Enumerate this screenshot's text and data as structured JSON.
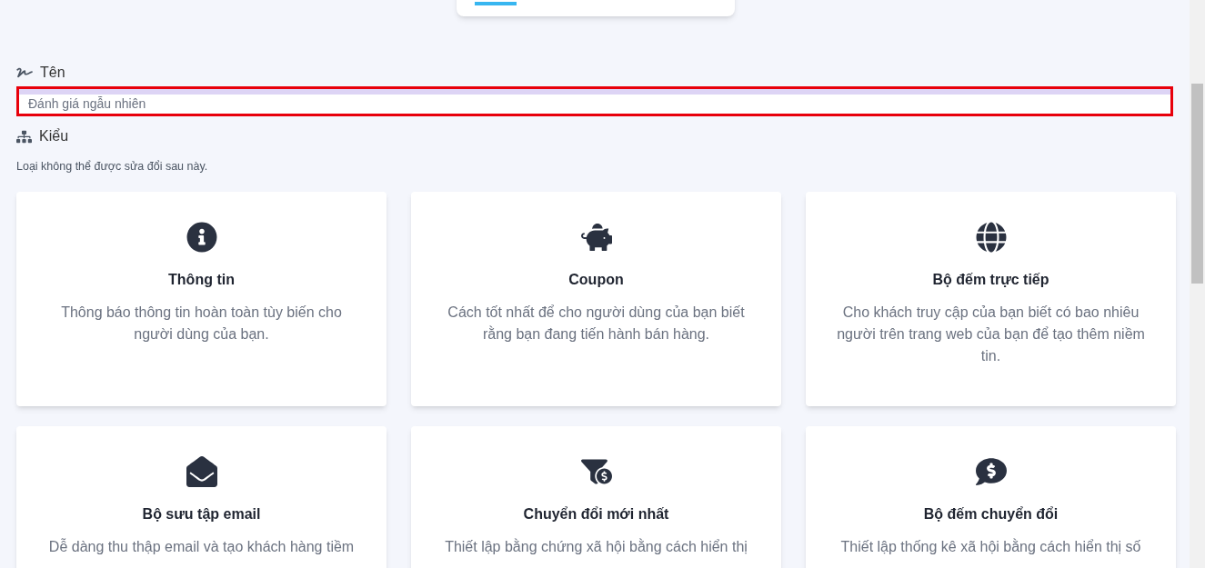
{
  "name_field": {
    "label": "Tên",
    "placeholder": "Đánh giá ngẫu nhiên",
    "highlighted": true
  },
  "type_section": {
    "label": "Kiểu",
    "hint": "Loại không thể được sửa đổi sau này."
  },
  "cards": [
    {
      "kind": "info",
      "title": "Thông tin",
      "description": "Thông báo thông tin hoàn toàn tùy biến cho người dùng của bạn."
    },
    {
      "kind": "coupon",
      "title": "Coupon",
      "description": "Cách tốt nhất để cho người dùng của bạn biết rằng bạn đang tiến hành bán hàng."
    },
    {
      "kind": "live",
      "title": "Bộ đếm trực tiếp",
      "description": "Cho khách truy cập của bạn biết có bao nhiêu người trên trang web của bạn để tạo thêm niềm tin."
    },
    {
      "kind": "email",
      "title": "Bộ sưu tập email",
      "description": "Dễ dàng thu thập email và tạo khách hàng tiềm"
    },
    {
      "kind": "conversion",
      "title": "Chuyển đổi mới nhất",
      "description": "Thiết lập bằng chứng xã hội bằng cách hiển thị"
    },
    {
      "kind": "counter",
      "title": "Bộ đếm chuyển đổi",
      "description": "Thiết lập thống kê xã hội bằng cách hiển thị số"
    }
  ]
}
